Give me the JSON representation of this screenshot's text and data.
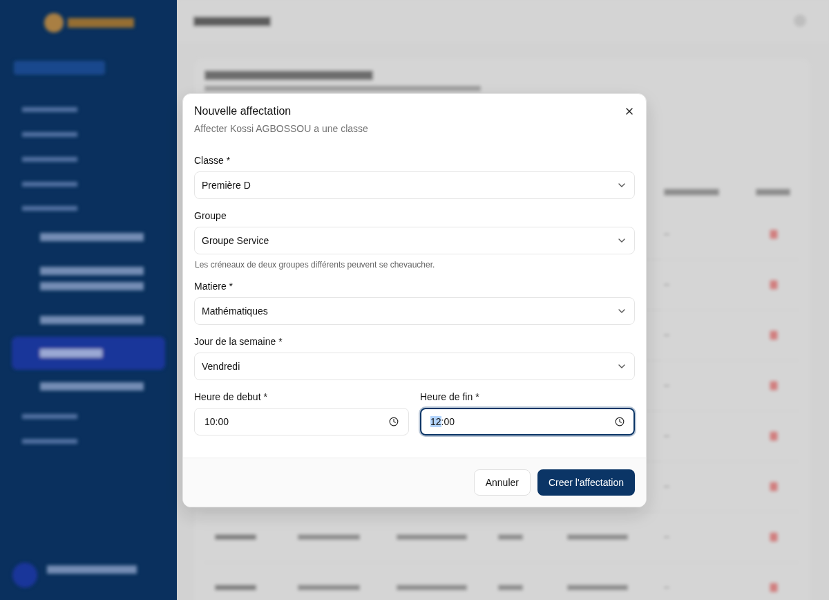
{
  "dialog": {
    "title": "Nouvelle affectation",
    "subtitle": "Affecter Kossi AGBOSSOU a une classe",
    "fields": [
      {
        "kind": "select",
        "label": "Classe *",
        "value": "Première D"
      },
      {
        "kind": "select",
        "label": "Groupe",
        "value": "Groupe Service",
        "hint": "Les créneaux de deux groupes différents peuvent se chevaucher."
      },
      {
        "kind": "select",
        "label": "Matiere *",
        "value": "Mathématiques"
      },
      {
        "kind": "select",
        "label": "Jour de la semaine *",
        "value": "Vendredi"
      }
    ],
    "time_fields": [
      {
        "label": "Heure de debut *",
        "focused": false,
        "value_parts": [
          {
            "text": "10",
            "selected": false
          },
          {
            "text": ":00",
            "selected": false
          }
        ]
      },
      {
        "label": "Heure de fin *",
        "focused": true,
        "value_parts": [
          {
            "text": "12",
            "selected": true
          },
          {
            "text": ":00",
            "selected": false
          }
        ]
      }
    ],
    "buttons": [
      {
        "kind": "secondary",
        "label": "Annuler"
      },
      {
        "kind": "primary",
        "label": "Creer l'affectation"
      }
    ]
  }
}
